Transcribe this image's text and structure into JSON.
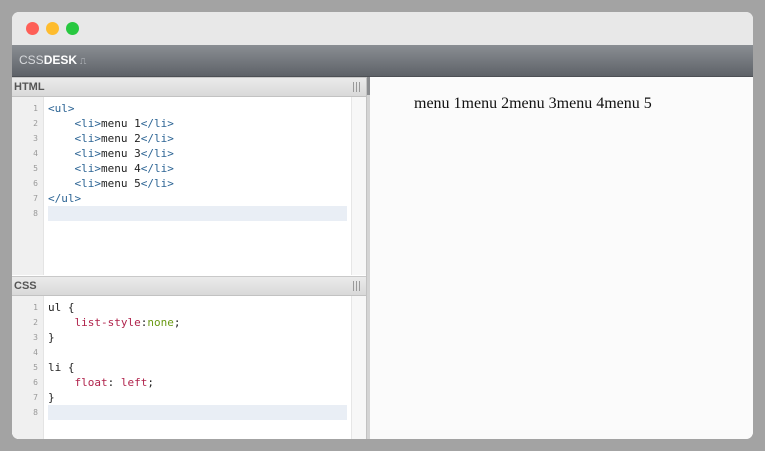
{
  "app": {
    "logo_thin": "CSS",
    "logo_bold": "DESK",
    "logo_mark": "⎍"
  },
  "html_panel": {
    "title": "HTML",
    "lines": [
      {
        "num": "1",
        "parts": [
          {
            "t": "<ul>",
            "c": "tag"
          }
        ]
      },
      {
        "num": "2",
        "parts": [
          {
            "t": "    ",
            "c": ""
          },
          {
            "t": "<li>",
            "c": "tag"
          },
          {
            "t": "menu 1",
            "c": ""
          },
          {
            "t": "</li>",
            "c": "tag"
          }
        ]
      },
      {
        "num": "3",
        "parts": [
          {
            "t": "    ",
            "c": ""
          },
          {
            "t": "<li>",
            "c": "tag"
          },
          {
            "t": "menu 2",
            "c": ""
          },
          {
            "t": "</li>",
            "c": "tag"
          }
        ]
      },
      {
        "num": "4",
        "parts": [
          {
            "t": "    ",
            "c": ""
          },
          {
            "t": "<li>",
            "c": "tag"
          },
          {
            "t": "menu 3",
            "c": ""
          },
          {
            "t": "</li>",
            "c": "tag"
          }
        ]
      },
      {
        "num": "5",
        "parts": [
          {
            "t": "    ",
            "c": ""
          },
          {
            "t": "<li>",
            "c": "tag"
          },
          {
            "t": "menu 4",
            "c": ""
          },
          {
            "t": "</li>",
            "c": "tag"
          }
        ]
      },
      {
        "num": "6",
        "parts": [
          {
            "t": "    ",
            "c": ""
          },
          {
            "t": "<li>",
            "c": "tag"
          },
          {
            "t": "menu 5",
            "c": ""
          },
          {
            "t": "</li>",
            "c": "tag"
          }
        ]
      },
      {
        "num": "7",
        "parts": [
          {
            "t": "</ul>",
            "c": "tag"
          }
        ]
      },
      {
        "num": "8",
        "parts": [],
        "active": true
      }
    ]
  },
  "css_panel": {
    "title": "CSS",
    "lines": [
      {
        "num": "1",
        "parts": [
          {
            "t": "ul {",
            "c": ""
          }
        ]
      },
      {
        "num": "2",
        "parts": [
          {
            "t": "    ",
            "c": ""
          },
          {
            "t": "list-style",
            "c": "prop"
          },
          {
            "t": ":",
            "c": ""
          },
          {
            "t": "none",
            "c": "val"
          },
          {
            "t": ";",
            "c": ""
          }
        ]
      },
      {
        "num": "3",
        "parts": [
          {
            "t": "}",
            "c": ""
          }
        ]
      },
      {
        "num": "4",
        "parts": []
      },
      {
        "num": "5",
        "parts": [
          {
            "t": "li {",
            "c": ""
          }
        ]
      },
      {
        "num": "6",
        "parts": [
          {
            "t": "    ",
            "c": ""
          },
          {
            "t": "float",
            "c": "prop"
          },
          {
            "t": ": ",
            "c": ""
          },
          {
            "t": "left",
            "c": "prop"
          },
          {
            "t": ";",
            "c": ""
          }
        ]
      },
      {
        "num": "7",
        "parts": [
          {
            "t": "}",
            "c": ""
          }
        ]
      },
      {
        "num": "8",
        "parts": [],
        "active": true
      }
    ]
  },
  "preview": {
    "text": "menu 1menu 2menu 3menu 4menu 5"
  }
}
